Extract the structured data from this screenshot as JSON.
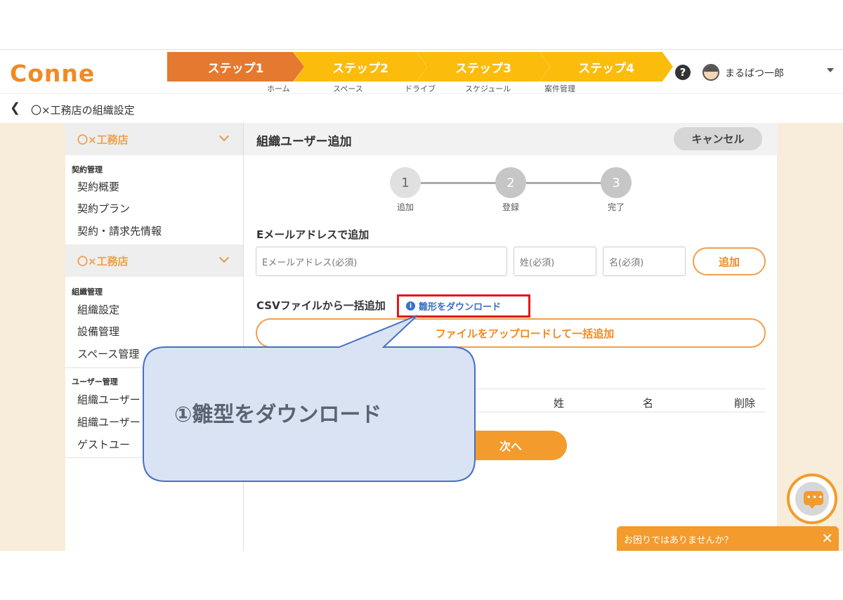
{
  "header": {
    "logo": "Conne",
    "steps": [
      "ステップ1",
      "ステップ2",
      "ステップ3",
      "ステップ4"
    ],
    "subnav": [
      "ホーム",
      "スペース",
      "ドライブ",
      "スケジュール",
      "案件管理"
    ],
    "username": "まるばつ一郎"
  },
  "breadcrumb": {
    "title": "〇×工務店の組織設定"
  },
  "sidebar": {
    "org_name_1": "〇×工務店",
    "contract_category": "契約管理",
    "contract_items": [
      "契約概要",
      "契約プラン",
      "契約・請求先情報"
    ],
    "org_name_2": "〇×工務店",
    "org_category": "組織管理",
    "org_items": [
      "組織設定",
      "設備管理",
      "スペース管理"
    ],
    "user_category": "ユーザー管理",
    "user_items": [
      "組織ユーザー",
      "組織ユーザー",
      "ゲストユー"
    ]
  },
  "main": {
    "title": "組織ユーザー追加",
    "cancel_label": "キャンセル",
    "progress": [
      {
        "num": "1",
        "label": "追加"
      },
      {
        "num": "2",
        "label": "登録"
      },
      {
        "num": "3",
        "label": "完了"
      }
    ],
    "email_section": "Eメールアドレスで追加",
    "email_placeholder": "Eメールアドレス(必須)",
    "last_placeholder": "姓(必須)",
    "first_placeholder": "名(必須)",
    "add_label": "追加",
    "csv_section": "CSVファイルから一括追加",
    "template_link": "雛形をダウンロード",
    "upload_label": "ファイルをアップロードして一括追加",
    "table_headers": {
      "last": "姓",
      "first": "名",
      "delete": "削除"
    },
    "next_label": "次へ"
  },
  "callout": {
    "text": "①雛型をダウンロード"
  },
  "help_bar": {
    "text": "お困りではありませんか？",
    "close": "✕"
  }
}
